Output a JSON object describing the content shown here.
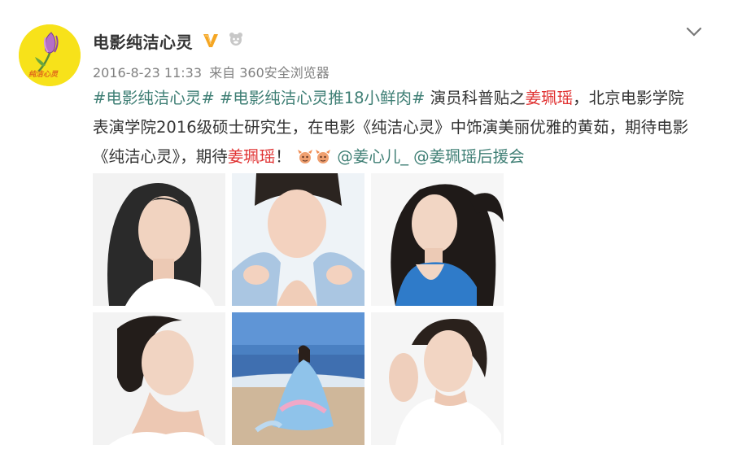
{
  "post": {
    "author": "电影纯洁心灵",
    "timestamp": "2016-8-23 11:33",
    "via_prefix": "来自",
    "source": "360安全浏览器",
    "hashtag_1": "#电影纯洁心灵#",
    "hashtag_2": "#电影纯洁心灵推18小鲜肉#",
    "text_1": "演员科普贴之",
    "highlight_name": "姜珮瑶",
    "text_2": "，北京电影学院表演学院2016级硕士研究生，在电影《纯洁心灵》中饰演美丽优雅的黄茹，期待电影《纯洁心灵》，期待",
    "text_3": "！",
    "mention_1": "@姜心儿_",
    "mention_2": "@姜珮瑶后援会"
  },
  "avatar_text": "纯洁心灵",
  "icons": {
    "verified": "verified-v-icon",
    "member": "member-badge-icon",
    "menu": "chevron-down-icon",
    "emoji": "cheer-emoji-icon"
  },
  "colors": {
    "link": "#3f7f75",
    "highlight": "#e03131",
    "verified": "#f5a623",
    "avatar_bg": "#f7e21a"
  }
}
